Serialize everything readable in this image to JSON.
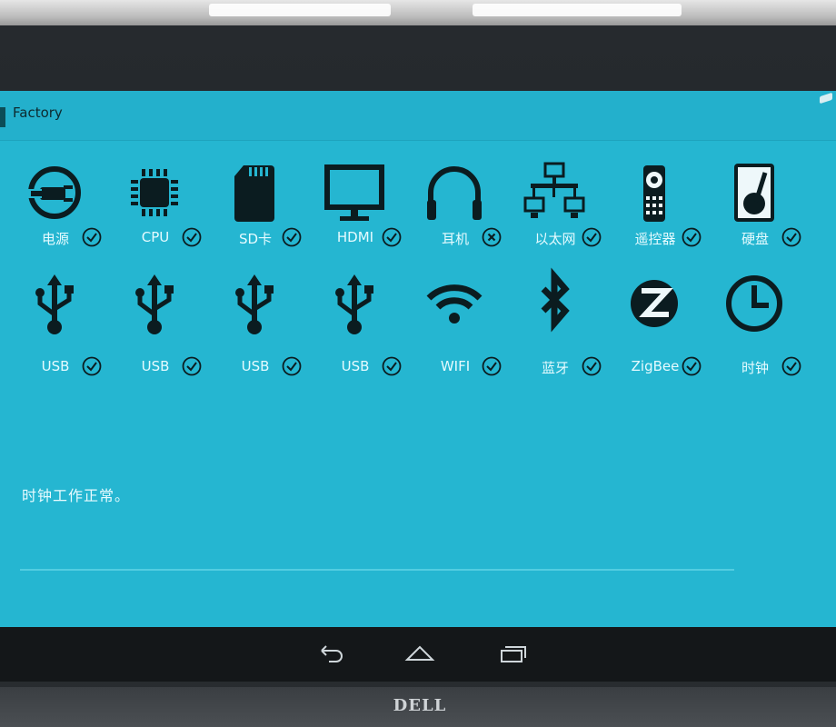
{
  "app": {
    "title": "Factory"
  },
  "tests": [
    {
      "label": "电源",
      "icon": "power-plug-icon",
      "status": "pass"
    },
    {
      "label": "CPU",
      "icon": "cpu-chip-icon",
      "status": "pass"
    },
    {
      "label": "SD卡",
      "icon": "sd-card-icon",
      "status": "pass"
    },
    {
      "label": "HDMI",
      "icon": "monitor-icon",
      "status": "pass"
    },
    {
      "label": "耳机",
      "icon": "headphones-icon",
      "status": "fail"
    },
    {
      "label": "以太网",
      "icon": "ethernet-network-icon",
      "status": "pass"
    },
    {
      "label": "遥控器",
      "icon": "remote-control-icon",
      "status": "pass"
    },
    {
      "label": "硬盘",
      "icon": "hard-disk-icon",
      "status": "pass"
    },
    {
      "label": "USB",
      "icon": "usb-icon",
      "status": "pass"
    },
    {
      "label": "USB",
      "icon": "usb-icon",
      "status": "pass"
    },
    {
      "label": "USB",
      "icon": "usb-icon",
      "status": "pass"
    },
    {
      "label": "USB",
      "icon": "usb-icon",
      "status": "pass"
    },
    {
      "label": "WIFI",
      "icon": "wifi-icon",
      "status": "pass"
    },
    {
      "label": "蓝牙",
      "icon": "bluetooth-icon",
      "status": "pass"
    },
    {
      "label": "ZigBee",
      "icon": "zigbee-icon",
      "status": "pass"
    },
    {
      "label": "时钟",
      "icon": "clock-icon",
      "status": "pass"
    }
  ],
  "status_message": "时钟工作正常。",
  "navbar": {
    "back": "back-icon",
    "home": "home-icon",
    "recents": "recents-icon"
  },
  "monitor_brand": "DELL",
  "colors": {
    "screen": "#25b6d1",
    "icon": "#0b1c20",
    "label": "#e6fbff"
  }
}
